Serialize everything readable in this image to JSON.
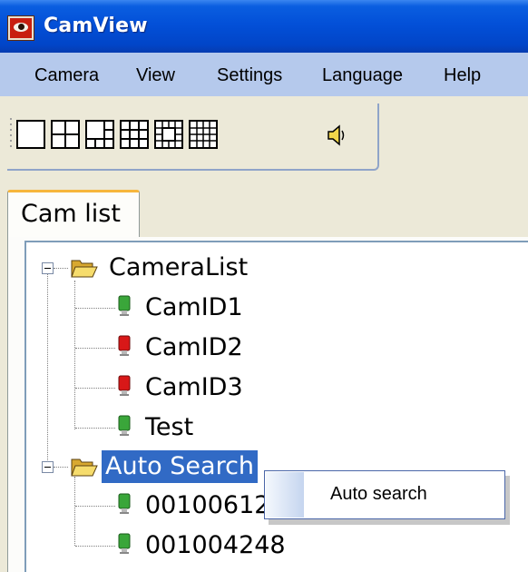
{
  "window": {
    "title": "CamView"
  },
  "menu": {
    "items": [
      "Camera",
      "View",
      "Settings",
      "Language",
      "Help"
    ]
  },
  "toolbar": {
    "buttons": [
      {
        "icon": "layout-1-icon"
      },
      {
        "icon": "layout-4-icon"
      },
      {
        "icon": "layout-6-icon"
      },
      {
        "icon": "layout-9-icon"
      },
      {
        "icon": "layout-13-icon"
      },
      {
        "icon": "layout-16-icon"
      },
      {
        "icon": "speaker-icon"
      }
    ]
  },
  "tabs": [
    {
      "label": "Cam list",
      "active": true
    }
  ],
  "tree": {
    "groups": [
      {
        "label": "CameraList",
        "expanded": true,
        "children": [
          {
            "label": "CamID1",
            "status": "online"
          },
          {
            "label": "CamID2",
            "status": "offline"
          },
          {
            "label": "CamID3",
            "status": "offline"
          },
          {
            "label": "Test",
            "status": "online"
          }
        ]
      },
      {
        "label": "Auto Search",
        "expanded": true,
        "selected": true,
        "children": [
          {
            "label": "00100612",
            "status": "online"
          },
          {
            "label": "001004248",
            "status": "online"
          }
        ]
      }
    ]
  },
  "context_menu": {
    "items": [
      "Auto search"
    ]
  },
  "colors": {
    "online": "#3aa63a",
    "offline": "#d81818",
    "selection": "#316ac5",
    "titlebar": "#0350d8",
    "menubar": "#b5c9ec"
  }
}
